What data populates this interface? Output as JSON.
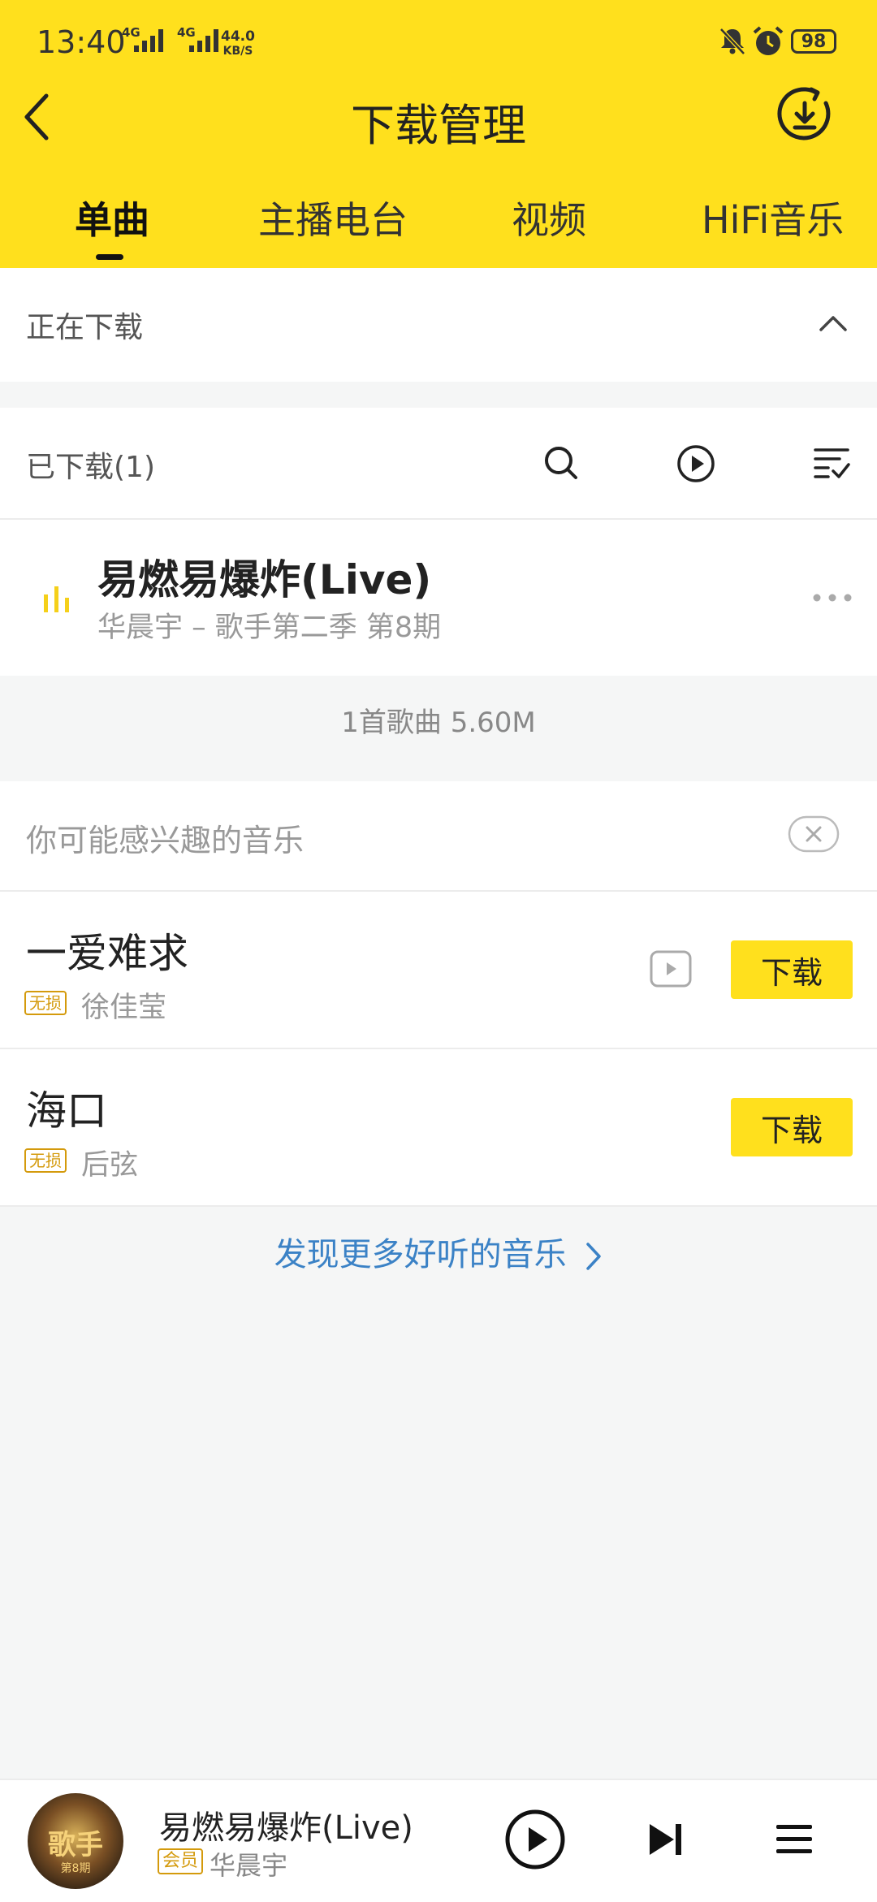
{
  "status_bar": {
    "time": "13:40",
    "network1": "4G",
    "network2": "4G",
    "speed_value": "44.0",
    "speed_unit": "KB/S",
    "battery": "98"
  },
  "header": {
    "title": "下载管理"
  },
  "tabs": [
    {
      "label": "单曲",
      "active": true
    },
    {
      "label": "主播电台",
      "active": false
    },
    {
      "label": "视频",
      "active": false
    },
    {
      "label": "HiFi音乐",
      "active": false
    }
  ],
  "downloading": {
    "label": "正在下载"
  },
  "downloaded": {
    "label": "已下载(1)",
    "songs": [
      {
        "title": "易燃易爆炸(Live)",
        "subtitle": "华晨宇 – 歌手第二季 第8期"
      }
    ],
    "summary": "1首歌曲 5.60M"
  },
  "recommend": {
    "label": "你可能感兴趣的音乐",
    "songs": [
      {
        "title": "一爱难求",
        "badge": "无损",
        "artist": "徐佳莹",
        "has_video": true,
        "button": "下载"
      },
      {
        "title": "海口",
        "badge": "无损",
        "artist": "后弦",
        "has_video": false,
        "button": "下载"
      }
    ]
  },
  "discover_more": "发现更多好听的音乐",
  "player": {
    "album_text": "歌手",
    "album_sub": "第8期",
    "title": "易燃易爆炸(Live)",
    "badge": "会员",
    "artist": "华晨宇"
  },
  "colors": {
    "accent": "#ffe01d",
    "link": "#3b82c6",
    "badge": "#d49a0c"
  }
}
